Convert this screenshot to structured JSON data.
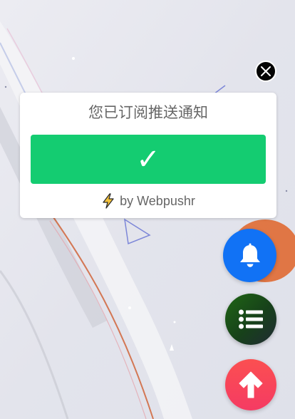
{
  "popup": {
    "title": "您已订阅推送通知",
    "confirm_glyph": "✓",
    "credit": "by Webpushr",
    "bolt_icon": "lightning-bolt-icon",
    "confirm_color": "#14cc71"
  },
  "close": {
    "icon": "close-icon"
  },
  "fabs": {
    "bell": {
      "icon": "bell-icon",
      "color": "#1172f5"
    },
    "list": {
      "icon": "list-icon",
      "color": "#1f6614"
    },
    "up": {
      "icon": "arrow-up-icon",
      "color": "#fb4f51"
    }
  }
}
